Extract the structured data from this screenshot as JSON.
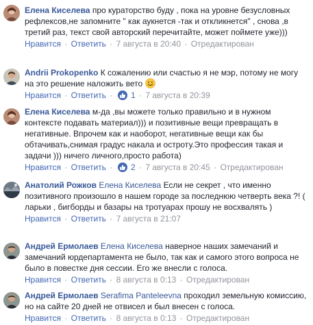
{
  "actions": {
    "like": "Нравится",
    "reply": "Ответить",
    "edited": "Отредактирован",
    "sep": "·"
  },
  "comments": [
    {
      "author": "Елена Киселева",
      "text": "про кураторство буду , пока на уровне безусловных рефлексов,не запомните \" как аукнется -так и откликнется\" , снова ,в третий раз, текст свой авторский перечитайте, может поймете уже)))",
      "date": "7 августа в 20:40",
      "edited": true
    },
    {
      "author": "Andrii Prokopenko",
      "text": "К сожалению или счастью я не мэр, потому не могу на это решение наложить вето",
      "emoji": "smile",
      "reactions": "1",
      "date": "7 августа в 20:39",
      "edited": false
    },
    {
      "author": "Елена Киселева",
      "text": "м-да ,вы можете только правильно и в нужном контексте подавать материал))) и позитивные вещи превращать в негативные. Впрочем как и наоборот, негативные вещи как бы обтачивать,снимая градус накала и остроту.Это профессия такая и задачи ))) ничего личного,просто работа)",
      "reactions": "2",
      "date": "7 августа в 20:45",
      "edited": true
    },
    {
      "author": "Анатолий Рожков",
      "mention": "Елена Киселева",
      "text": "Если не секрет , что именно позитивного произошло в нашем городе за последнюю четверть века ?! ( ларьки , бигборды и базары на тротуарах прошу не восхвалять )",
      "date": "7 августа в 21:07",
      "edited": false
    },
    {
      "author": "Андрей Ермолаев",
      "mention": "Елена Киселева",
      "text": "наверное наших замечаний и замечаний юрдепартамента не было, так как и самого этого вопроса не было в повестке дня сессии. Его же внесли с голоса.",
      "date": "8 августа в 0:13",
      "edited": true
    },
    {
      "author": "Андрей Ермолаев",
      "mention": "Serafima Panteleevna",
      "text": "проходил земельную комиссию, но на сайте 20 дней не отвисел и был внесен с голоса.",
      "date": "8 августа в 0:13",
      "edited": true
    }
  ],
  "colors": {
    "link": "#385898",
    "action": "#4267b2",
    "meta": "#90949c",
    "text": "#1d2129"
  }
}
